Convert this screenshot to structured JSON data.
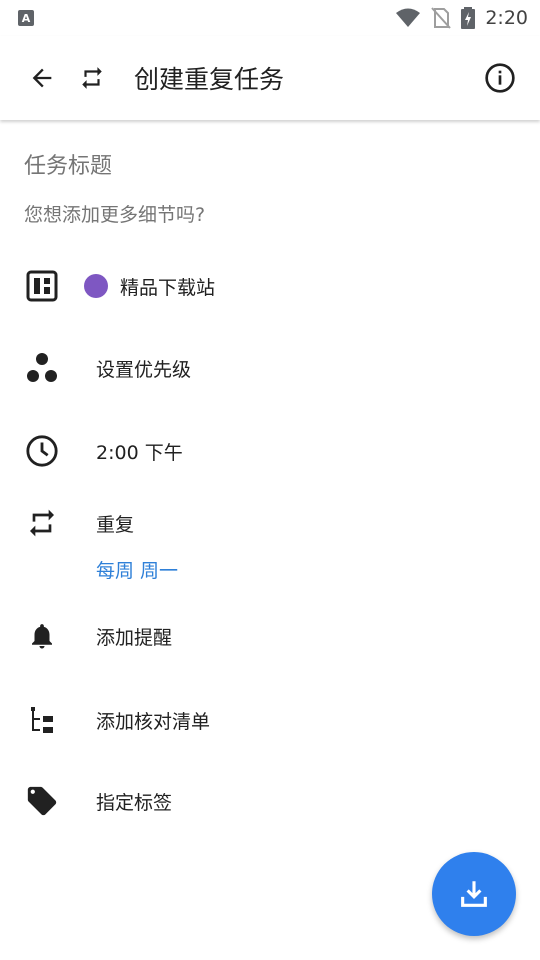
{
  "status_bar": {
    "app_icon": "A",
    "time": "2:20",
    "icons": [
      "wifi-icon",
      "no-sim-icon",
      "battery-charging-icon"
    ]
  },
  "app_bar": {
    "title": "创建重复任务",
    "icons": [
      "back-arrow-icon",
      "repeat-icon",
      "info-icon"
    ]
  },
  "form": {
    "task_title_placeholder": "任务标题",
    "task_details_placeholder": "您想添加更多细节吗?",
    "project": {
      "label": "精品下载站",
      "color": "#7e57c2",
      "icon": "board-icon"
    },
    "priority": {
      "label": "设置优先级",
      "icon": "priority-dots-icon"
    },
    "time": {
      "label": "2:00 下午",
      "icon": "clock-icon"
    },
    "repeat": {
      "label": "重复",
      "value": "每周 周一",
      "icon": "repeat-icon"
    },
    "reminder": {
      "label": "添加提醒",
      "icon": "bell-icon"
    },
    "checklist": {
      "label": "添加核对清单",
      "icon": "checklist-icon"
    },
    "tags": {
      "label": "指定标签",
      "icon": "tag-icon"
    }
  },
  "fab": {
    "icon": "download-icon",
    "color": "#2f80ed"
  },
  "colors": {
    "accent": "#2f80d8",
    "icon": "#3c4043"
  }
}
